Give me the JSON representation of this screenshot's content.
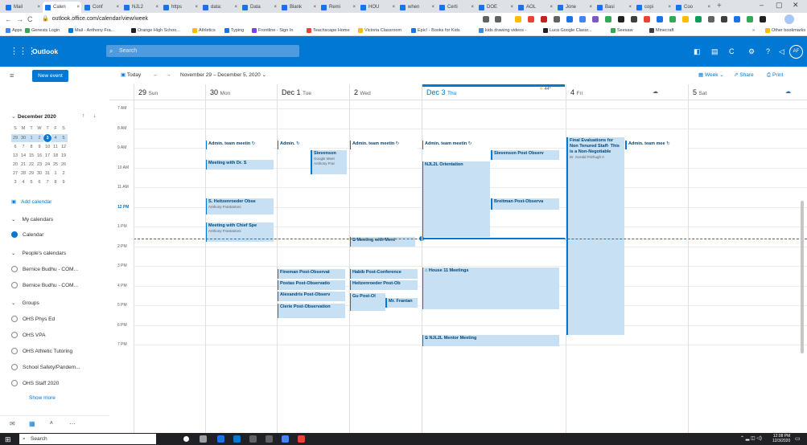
{
  "browser": {
    "tabs": [
      {
        "label": "Mail",
        "active": false
      },
      {
        "label": "Calen",
        "active": true
      },
      {
        "label": "Conf",
        "active": false
      },
      {
        "label": "NJL2",
        "active": false
      },
      {
        "label": "https",
        "active": false
      },
      {
        "label": "data:",
        "active": false
      },
      {
        "label": "Data",
        "active": false
      },
      {
        "label": "Blank",
        "active": false
      },
      {
        "label": "Remi",
        "active": false
      },
      {
        "label": "HOU",
        "active": false
      },
      {
        "label": "when",
        "active": false
      },
      {
        "label": "Certi",
        "active": false
      },
      {
        "label": "DOE",
        "active": false
      },
      {
        "label": "AOL",
        "active": false
      },
      {
        "label": "Jone",
        "active": false
      },
      {
        "label": "Basi",
        "active": false
      },
      {
        "label": "copi",
        "active": false
      },
      {
        "label": "Coo",
        "active": false
      }
    ],
    "new_tab": "+",
    "window_controls": {
      "minimize": "–",
      "restore": "▢",
      "close": "✕"
    },
    "nav": {
      "back": "←",
      "forward": "→",
      "reload": "C"
    },
    "url": "outlook.office.com/calendar/view/week",
    "bookmarks": [
      {
        "label": "Apps",
        "color": "#4285f4"
      },
      {
        "label": "Genesis Login",
        "color": "#34a853"
      },
      {
        "label": "Mail - Anthony Fra...",
        "color": "#0078d4"
      },
      {
        "label": "Orange High Schoo...",
        "color": "#202124"
      },
      {
        "label": "Athletics",
        "color": "#fbbc04"
      },
      {
        "label": "Typing",
        "color": "#1a73e8"
      },
      {
        "label": "Frontline - Sign In",
        "color": "#7e3ff2"
      },
      {
        "label": "Teachscape Home",
        "color": "#ea4335"
      },
      {
        "label": "Victoria Classroom",
        "color": "#fbbc04"
      },
      {
        "label": "Epic! - Books for Kids",
        "color": "#1a73e8"
      },
      {
        "label": "kids drawing videos -",
        "color": "#4285f4"
      },
      {
        "label": "Luca Google Classr...",
        "color": "#202124"
      },
      {
        "label": "Seesaw",
        "color": "#34a853"
      },
      {
        "label": "Minecraft",
        "color": "#3c4043"
      }
    ],
    "bookmarks_more": "»",
    "other_bookmarks": "Other bookmarks"
  },
  "outlook": {
    "brand": "Outlook",
    "search_placeholder": "Search",
    "avatar": "AF",
    "new_event": "New event",
    "today_btn": "Today",
    "date_range": "November 29 – December 5, 2020",
    "view_btn": "Week",
    "share_btn": "Share",
    "print_btn": "Print",
    "accent": "#0078d4"
  },
  "minical": {
    "title": "December 2020",
    "weekdays": [
      "S",
      "M",
      "T",
      "W",
      "T",
      "F",
      "S"
    ],
    "weeks": [
      [
        "29",
        "30",
        "1",
        "2",
        "3",
        "4",
        "5"
      ],
      [
        "6",
        "7",
        "8",
        "9",
        "10",
        "11",
        "12"
      ],
      [
        "13",
        "14",
        "15",
        "16",
        "17",
        "18",
        "19"
      ],
      [
        "20",
        "21",
        "22",
        "23",
        "24",
        "25",
        "26"
      ],
      [
        "27",
        "28",
        "29",
        "30",
        "31",
        "1",
        "2"
      ],
      [
        "3",
        "4",
        "5",
        "6",
        "7",
        "8",
        "9"
      ]
    ],
    "today": "3"
  },
  "leftnav": {
    "add_calendar": "Add calendar",
    "my_calendars": "My calendars",
    "calendar": "Calendar",
    "peoples_calendars": "People's calendars",
    "people": [
      "Bernice Budhu - COM...",
      "Bernice Budhu - COM..."
    ],
    "groups": "Groups",
    "group_items": [
      "OHS Phys Ed",
      "OHS VPA",
      "OHS Athletic Tutoring",
      "School Safety/Pandem...",
      "OHS Staff 2020"
    ],
    "show_more": "Show more"
  },
  "days": [
    {
      "num": "29",
      "name": "Sun"
    },
    {
      "num": "30",
      "name": "Mon"
    },
    {
      "num": "Dec 1",
      "name": "Tue"
    },
    {
      "num": "2",
      "name": "Wed"
    },
    {
      "num": "Dec 3",
      "name": "Thu"
    },
    {
      "num": "4",
      "name": "Fri"
    },
    {
      "num": "5",
      "name": "Sat"
    }
  ],
  "weather": "44°",
  "times": [
    "7 AM",
    "8 AM",
    "9 AM",
    "10 AM",
    "11 AM",
    "12 PM",
    "1 PM",
    "2 PM",
    "3 PM",
    "4 PM",
    "5 PM",
    "6 PM",
    "7 PM"
  ],
  "events": {
    "mon_admin": "Admin. team meetin",
    "mon_drs": "Meeting with Dr. S",
    "mon_heitz": "S. Heitzenroeder Obse",
    "mon_heitz_sub": "Anthony Frantantoni",
    "mon_chief": "Meeting with Chief Spe",
    "mon_chief_sub": "Anthony Frantantoni",
    "tue_admin": "Admin.",
    "tue_stevenson": "Stevenson",
    "tue_stevenson_sub1": "Google Meet",
    "tue_stevenson_sub2": "Anthony Frar",
    "tue_fineman": "Fineman Post-Observat",
    "tue_postas": "Postas Post-Observatio",
    "tue_alexandris": "Alexandris Post-Observ",
    "tue_clerie": "Clerie Post-Observation",
    "wed_admin": "Admin. team meetin",
    "wed_mentor": "Meeting with Ment",
    "wed_habib": "Habib Post-Conference",
    "wed_heitz": "Heitzenroeder Post-Ob",
    "wed_gu": "Gu Post-Ol",
    "wed_frantan": "Mr. Frantan",
    "thu_admin": "Admin. team meetin",
    "thu_stevenson": "Stevenson Post Observ",
    "thu_njl2l": "NJL2L Orientation",
    "thu_breitman": "Breitman Post-Observa",
    "thu_house": "House 11 Meetings",
    "thu_mentor": "NJL2L Mentor Meeting",
    "fri_final": "Final Evaluations for Non Tenured Staff- This is a Non-Negotiable",
    "fri_final_sub": "Dr. Gerald Fitzhugh II",
    "fri_admin": "Admin. team mee"
  },
  "taskbar": {
    "search": "Search",
    "time": "12:08 PM",
    "date": "12/3/2020"
  }
}
